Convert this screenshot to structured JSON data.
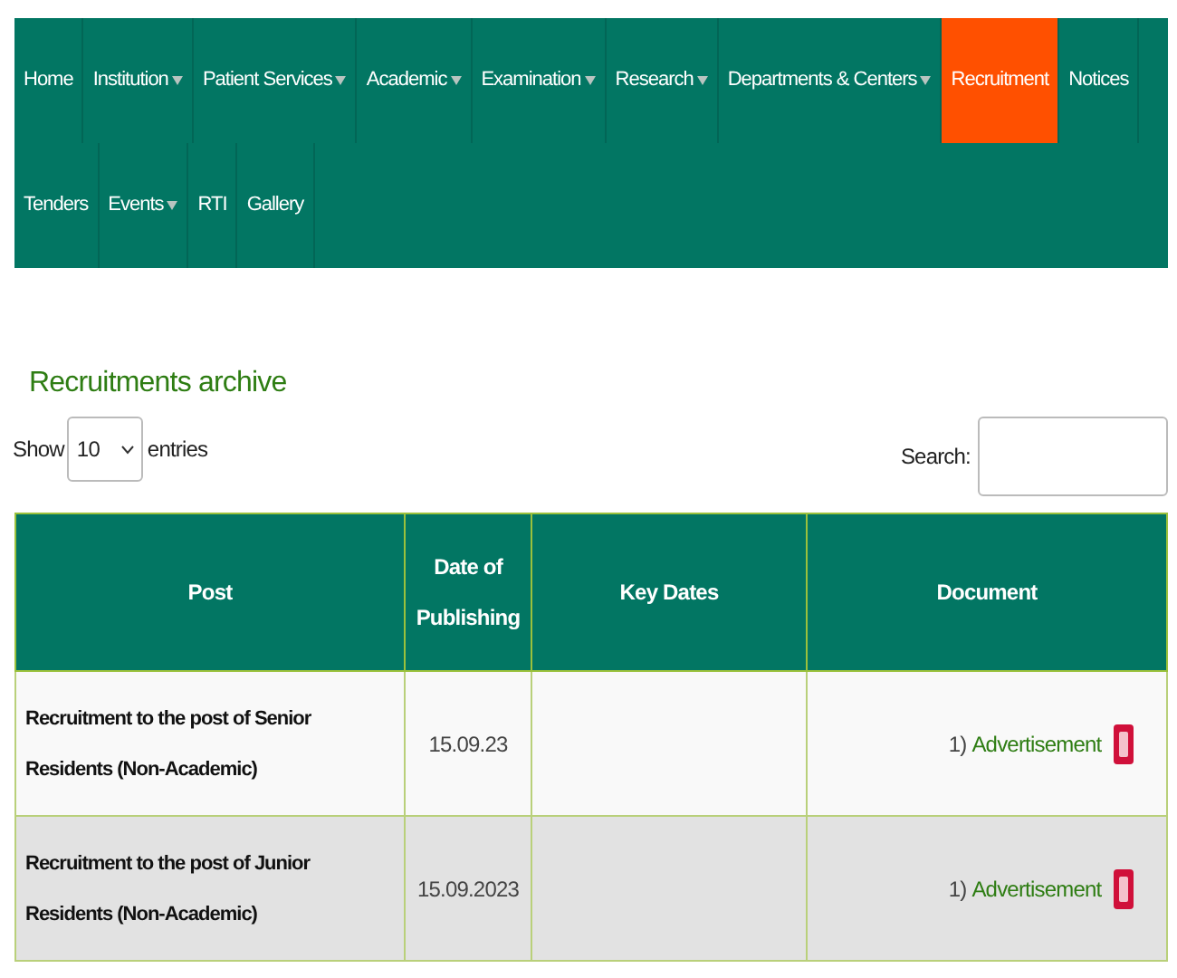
{
  "nav": {
    "items": [
      {
        "label": "Home",
        "dropdown": false,
        "selected": false
      },
      {
        "label": "Institution",
        "dropdown": true,
        "selected": false
      },
      {
        "label": "Patient Services",
        "dropdown": true,
        "selected": false
      },
      {
        "label": "Academic",
        "dropdown": true,
        "selected": false
      },
      {
        "label": "Examination",
        "dropdown": true,
        "selected": false
      },
      {
        "label": "Research",
        "dropdown": true,
        "selected": false
      },
      {
        "label": "Departments & Centers",
        "dropdown": true,
        "selected": false
      },
      {
        "label": "Recruitment",
        "dropdown": false,
        "selected": true
      },
      {
        "label": "Notices",
        "dropdown": false,
        "selected": false
      },
      {
        "label": "Tenders",
        "dropdown": false,
        "selected": false
      },
      {
        "label": "Events",
        "dropdown": true,
        "selected": false
      },
      {
        "label": "RTI",
        "dropdown": false,
        "selected": false
      },
      {
        "label": "Gallery",
        "dropdown": false,
        "selected": false
      }
    ]
  },
  "heading": "Recruitments archive",
  "length": {
    "before": "Show",
    "value": "10",
    "after": "entries"
  },
  "search": {
    "label": "Search:"
  },
  "table": {
    "columns": [
      "Post",
      "Date of Publishing",
      "Key Dates",
      "Document"
    ],
    "rows": [
      {
        "post": "Recruitment to the post of Senior Residents (Non-Academic)",
        "date": "15.09.23",
        "document": {
          "number": "1)",
          "link": "Advertisement",
          "new": true
        }
      },
      {
        "post": "Recruitment to the post of Junior Residents (Non-Academic)",
        "date": "15.09.2023",
        "document": {
          "number": "1)",
          "link": "Advertisement",
          "new": true
        }
      }
    ]
  }
}
